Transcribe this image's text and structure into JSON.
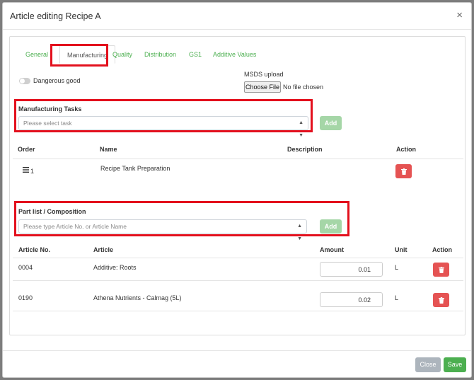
{
  "modal": {
    "title": "Article editing Recipe A",
    "close_glyph": "×"
  },
  "tabs": [
    {
      "label": "General"
    },
    {
      "label": "Manufacturing"
    },
    {
      "label": "Quality"
    },
    {
      "label": "Distribution"
    },
    {
      "label": "GS1"
    },
    {
      "label": "Additive Values"
    }
  ],
  "active_tab": "Manufacturing",
  "dangerous_good": {
    "label": "Dangerous good",
    "checked": false
  },
  "msds": {
    "label": "MSDS upload",
    "button": "Choose File",
    "status": "No file chosen"
  },
  "manufacturing_tasks": {
    "label": "Manufacturing Tasks",
    "placeholder": "Please select task",
    "add_label": "Add",
    "columns": {
      "order": "Order",
      "name": "Name",
      "description": "Description",
      "action": "Action"
    },
    "rows": [
      {
        "order": "1",
        "name": "Recipe Tank Preparation",
        "description": ""
      }
    ]
  },
  "part_list": {
    "label": "Part list / Composition",
    "placeholder": "Please type Article No. or Article Name",
    "add_label": "Add",
    "columns": {
      "article_no": "Article No.",
      "article": "Article",
      "amount": "Amount",
      "unit": "Unit",
      "action": "Action"
    },
    "rows": [
      {
        "article_no": "0004",
        "article": "Additive: Roots",
        "amount": "0.01",
        "unit": "L"
      },
      {
        "article_no": "0190",
        "article": "Athena Nutrients - Calmag (5L)",
        "amount": "0.02",
        "unit": "L"
      }
    ]
  },
  "footer": {
    "close_label": "Close",
    "save_label": "Save"
  },
  "icons": {
    "drag_handle": "drag-handle-icon",
    "trash": "trash-icon",
    "chevron": "chevron-updown-icon"
  },
  "colors": {
    "accent_green": "#4caf50",
    "danger": "#e55353",
    "highlight": "#e3101d"
  }
}
